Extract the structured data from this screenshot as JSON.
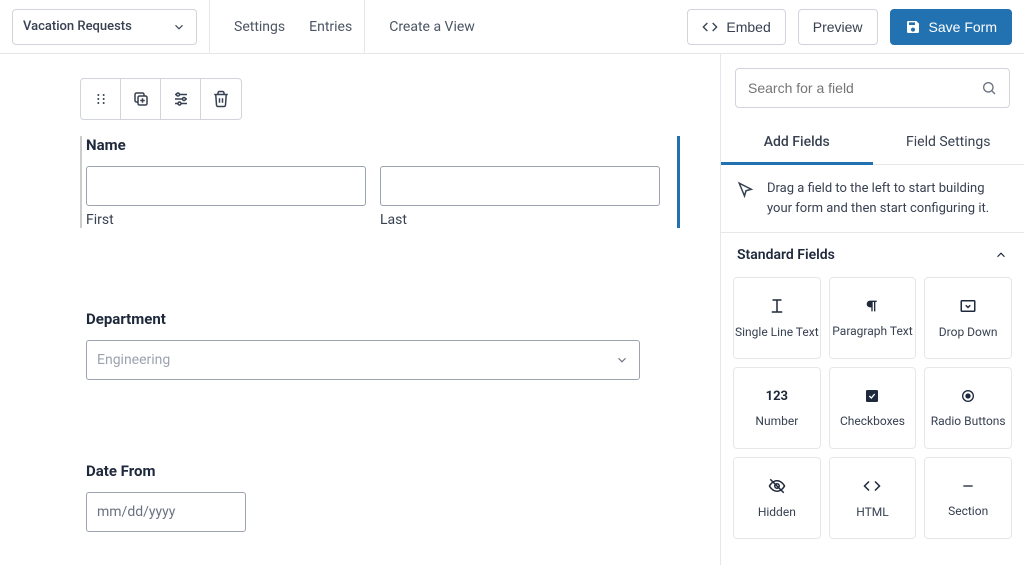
{
  "header": {
    "form_name": "Vacation Requests",
    "nav": {
      "settings": "Settings",
      "entries": "Entries",
      "create_view": "Create a View"
    },
    "embed": "Embed",
    "preview": "Preview",
    "save": "Save Form"
  },
  "canvas": {
    "name_field": {
      "label": "Name",
      "first": "First",
      "last": "Last"
    },
    "department": {
      "label": "Department",
      "placeholder": "Engineering"
    },
    "date_from": {
      "label": "Date From",
      "placeholder": "mm/dd/yyyy"
    }
  },
  "sidebar": {
    "search_placeholder": "Search for a field",
    "tabs": {
      "add": "Add Fields",
      "settings": "Field Settings"
    },
    "hint": "Drag a field to the left to start building your form and then start configuring it.",
    "section_head": "Standard Fields",
    "fields": {
      "single_line": "Single Line Text",
      "paragraph": "Paragraph Text",
      "dropdown": "Drop Down",
      "number": "Number",
      "checkboxes": "Checkboxes",
      "radio": "Radio Buttons",
      "hidden": "Hidden",
      "html": "HTML",
      "section": "Section"
    }
  }
}
